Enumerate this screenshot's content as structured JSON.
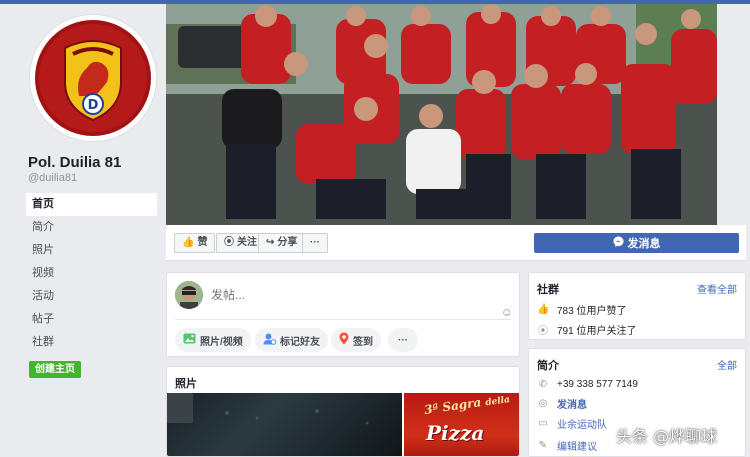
{
  "page": {
    "name": "Pol. Duilia 81",
    "handle": "@duilia81"
  },
  "nav": {
    "items": [
      {
        "label": "首页",
        "active": true
      },
      {
        "label": "简介"
      },
      {
        "label": "照片"
      },
      {
        "label": "视频"
      },
      {
        "label": "活动"
      },
      {
        "label": "帖子"
      },
      {
        "label": "社群"
      }
    ],
    "create_label": "创建主页"
  },
  "actions": {
    "like": "赞",
    "follow": "关注",
    "share": "分享",
    "more": "···",
    "message": "发消息"
  },
  "composer": {
    "placeholder": "发帖...",
    "photo_video": "照片/视频",
    "tag_friends": "标记好友",
    "check_in": "签到",
    "more": "···"
  },
  "photos": {
    "title": "照片",
    "poster_line1": "3ª Sagra",
    "poster_line2": "della",
    "poster_word": "Pizza"
  },
  "community": {
    "title": "社群",
    "see_all": "查看全部",
    "likes": "783 位用户赞了",
    "follows": "791 位用户关注了"
  },
  "about": {
    "title": "简介",
    "see_all": "全部",
    "phone": "+39 338 577 7149",
    "message": "发消息",
    "category": "业余运动队",
    "edit": "编辑建议"
  },
  "watermark": "头条 @烨聊球",
  "colors": {
    "brand": "#4267b2",
    "create_button": "#42b72a",
    "jersey_red": "#d7252a"
  }
}
